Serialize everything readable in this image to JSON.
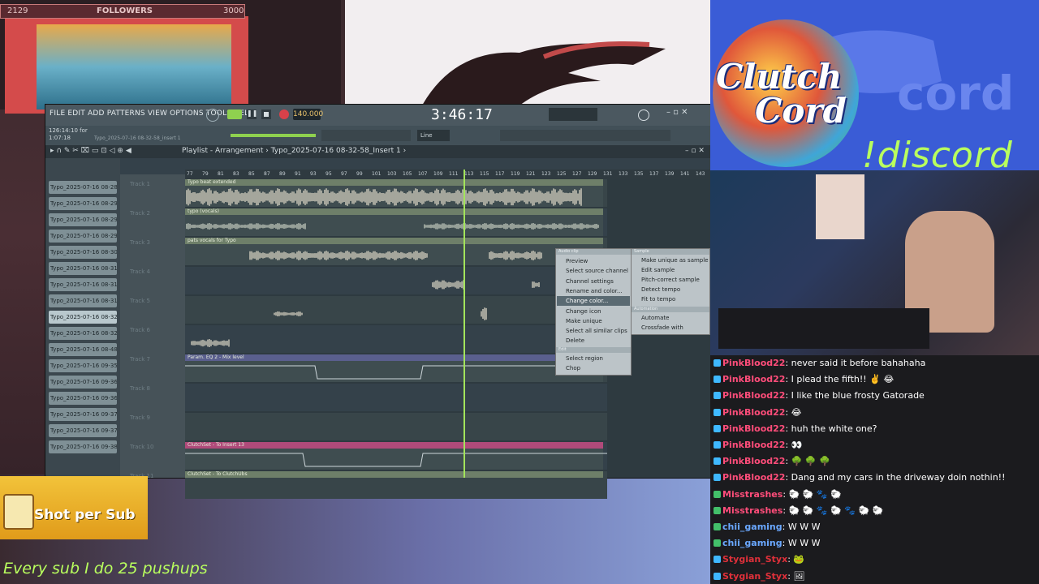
{
  "followers": {
    "left": "2129",
    "label": "FOLLOWERS",
    "right": "3000"
  },
  "fl": {
    "menu": "FILE  EDIT  ADD  PATTERNS  VIEW  OPTIONS  TOOLS  HELP",
    "tempo": "140.000",
    "time": "3:46:17",
    "hint_line1": "126:14:10 for",
    "hint_line2": "1:07:18",
    "hint_file": "Typo_2025-07-16 08-32-58_insert 1",
    "playlist_title": "Playlist - Arrangement  ›  Typo_2025-07-16 08-32-58_Insert 1  ›",
    "snap": "Line",
    "tracklist": [
      "Typo_2025-07-16 08-28...",
      "Typo_2025-07-16 08-29...",
      "Typo_2025-07-16 08-29...",
      "Typo_2025-07-16 08-29...",
      "Typo_2025-07-16 08-30...",
      "Typo_2025-07-16 08-31...",
      "Typo_2025-07-16 08-31...",
      "Typo_2025-07-16 08-31...",
      "Typo_2025-07-16 08-32...",
      "Typo_2025-07-16 08-32...",
      "Typo_2025-07-16 08-48...",
      "Typo_2025-07-16 09-35...",
      "Typo_2025-07-16 09-36...",
      "Typo_2025-07-16 09-36...",
      "Typo_2025-07-16 09-37...",
      "Typo_2025-07-16 09-37...",
      "Typo_2025-07-16 09-38..."
    ],
    "track_names": [
      "Track 1",
      "Track 2",
      "Track 3",
      "Track 4",
      "Track 5",
      "Track 6",
      "Track 7",
      "Track 8",
      "Track 9",
      "Track 10",
      "Track 11"
    ],
    "ruler": [
      "77",
      "79",
      "81",
      "83",
      "85",
      "87",
      "89",
      "91",
      "93",
      "95",
      "97",
      "99",
      "101",
      "103",
      "105",
      "107",
      "109",
      "111",
      "113",
      "115",
      "117",
      "119",
      "121",
      "123",
      "125",
      "127",
      "129",
      "131",
      "133",
      "135",
      "137",
      "139",
      "141",
      "143"
    ],
    "clips": {
      "t1": "Typo beat extended",
      "t2": "typo (vocals)",
      "t3": "pats vocals for Typo",
      "t7": "Param. EQ 2 - Mix level",
      "t10": "ClutchSet - To Insert 13",
      "t11": "ClutchSet - To ClutchUbs"
    },
    "context_menu": {
      "section1": "Audio clip",
      "items1": [
        "Preview",
        "Select source channel",
        "Channel settings",
        "Rename and color...",
        "Change color...",
        "Change icon",
        "Make unique",
        "Select all similar clips",
        "Delete"
      ],
      "section2": "Edit",
      "items2": [
        "Select region",
        "Chop"
      ],
      "sub_section1": "Sample",
      "sub_items1": [
        "Make unique as sample",
        "Edit sample",
        "Pitch-correct sample",
        "Detect tempo",
        "Fit to tempo"
      ],
      "sub_section2": "Automation",
      "sub_items2": [
        "Automate",
        "Crossfade with"
      ]
    }
  },
  "clutch": {
    "line1": "Clutch",
    "line2": "Cord",
    "discord": "!discord"
  },
  "chat": [
    {
      "user": "PinkBlood22",
      "color": "#ff4d7a",
      "msg": ": never said it before bahahaha"
    },
    {
      "user": "PinkBlood22",
      "color": "#ff4d7a",
      "msg": ": I plead the fifth!! ✌️ 😂"
    },
    {
      "user": "PinkBlood22",
      "color": "#ff4d7a",
      "msg": ": I like the blue frosty Gatorade"
    },
    {
      "user": "PinkBlood22",
      "color": "#ff4d7a",
      "msg": ": 😂"
    },
    {
      "user": "PinkBlood22",
      "color": "#ff4d7a",
      "msg": ": huh the white one?"
    },
    {
      "user": "PinkBlood22",
      "color": "#ff4d7a",
      "msg": ": 👀"
    },
    {
      "user": "PinkBlood22",
      "color": "#ff4d7a",
      "msg": ": 🌳 🌳 🌳"
    },
    {
      "user": "PinkBlood22",
      "color": "#ff4d7a",
      "msg": ": Dang and my cars in the driveway doin nothin!!"
    },
    {
      "user": "Misstrashes",
      "color": "#ff4d7a",
      "msg": ": 🐑 🐑 🐾 🐑"
    },
    {
      "user": "Misstrashes",
      "color": "#ff4d7a",
      "msg": ": 🐑 🐑 🐾 🐑 🐾 🐑 🐑"
    },
    {
      "user": "chii_gaming",
      "color": "#6aa8ff",
      "msg": ": W  W  W"
    },
    {
      "user": "chii_gaming",
      "color": "#6aa8ff",
      "msg": ": W  W  W"
    },
    {
      "user": "Stygian_Styx",
      "color": "#e0303a",
      "msg": ": 🐸"
    },
    {
      "user": "Stygian_Styx",
      "color": "#e0303a",
      "msg": ": 🖼"
    }
  ],
  "overlay": {
    "shot": "Shot per Sub",
    "pushups": "Every sub I do 25 pushups"
  }
}
